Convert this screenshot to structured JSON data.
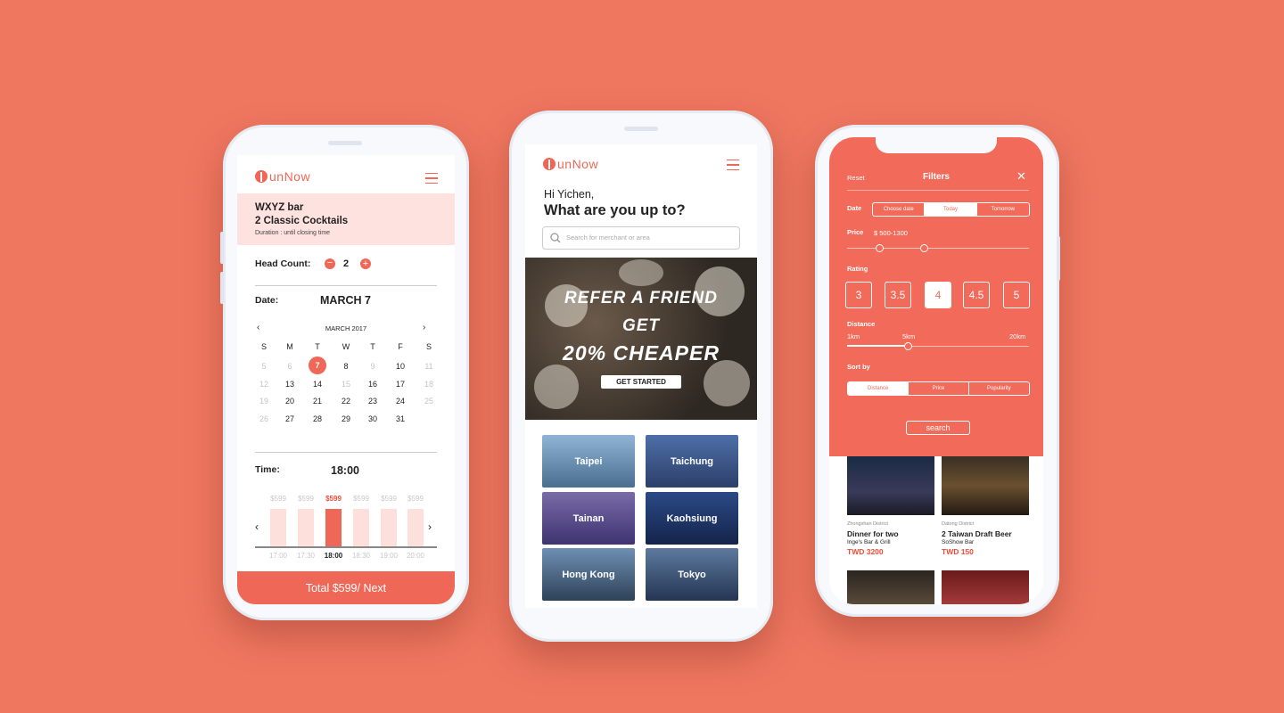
{
  "colors": {
    "background": "#ef7760",
    "accent": "#ef6756"
  },
  "booking": {
    "logo": "unNow",
    "venue": "WXYZ bar",
    "offer": "2 Classic Cocktails",
    "duration": "Duration : until closing time",
    "headcount_label": "Head Count:",
    "headcount_value": "2",
    "date_label": "Date:",
    "date_value": "MARCH 7",
    "calendar_month": "MARCH 2017",
    "weekdays": [
      "S",
      "M",
      "T",
      "W",
      "T",
      "F",
      "S"
    ],
    "days": [
      [
        "5",
        "6",
        "7",
        "8",
        "9",
        "10",
        "11"
      ],
      [
        "12",
        "13",
        "14",
        "15",
        "16",
        "17",
        "18"
      ],
      [
        "19",
        "20",
        "21",
        "22",
        "23",
        "24",
        "25"
      ],
      [
        "26",
        "27",
        "28",
        "29",
        "30",
        "31",
        ""
      ]
    ],
    "selected_day": "7",
    "time_label": "Time:",
    "time_value": "18:00",
    "slots": [
      {
        "price": "$599",
        "time": "17:00"
      },
      {
        "price": "$599",
        "time": "17:30"
      },
      {
        "price": "$599",
        "time": "18:00"
      },
      {
        "price": "$599",
        "time": "18:30"
      },
      {
        "price": "$599",
        "time": "19:00"
      },
      {
        "price": "$599",
        "time": "20:00"
      }
    ],
    "selected_slot": 2,
    "cta": "Total $599/ Next"
  },
  "home": {
    "logo": "unNow",
    "greeting": "Hi Yichen,",
    "headline": "What are you up to?",
    "search_placeholder": "Search for merchant or area",
    "banner_line1": "REFER A FRIEND",
    "banner_line2": "GET",
    "banner_line3": "20% CHEAPER",
    "banner_button": "GET STARTED",
    "cities": [
      "Taipei",
      "Taichung",
      "Tainan",
      "Kaohsiung",
      "Hong Kong",
      "Tokyo"
    ]
  },
  "filters": {
    "reset": "Reset",
    "title": "Filters",
    "date_label": "Date",
    "date_options": [
      "Choose date",
      "Today",
      "Tomorrow"
    ],
    "date_selected": 1,
    "price_label": "Price",
    "price_value": "$ 500-1300",
    "rating_label": "Rating",
    "ratings": [
      "3",
      "3.5",
      "4",
      "4.5",
      "5"
    ],
    "rating_selected": 2,
    "distance_label": "Distance",
    "distance_ticks": [
      "1km",
      "5km",
      "20km"
    ],
    "sort_label": "Sort by",
    "sort_options": [
      "Distance",
      "Price",
      "Popularity"
    ],
    "sort_selected": 0,
    "search_button": "search",
    "results": [
      {
        "district": "Zhongshan District",
        "title": "Dinner for two",
        "venue": "Inge's Bar & Grill",
        "price": "TWD 3200"
      },
      {
        "district": "Datong District",
        "title": "2 Taiwan Draft Beer",
        "venue": "SoShow Bar",
        "price": "TWD 150"
      }
    ]
  }
}
